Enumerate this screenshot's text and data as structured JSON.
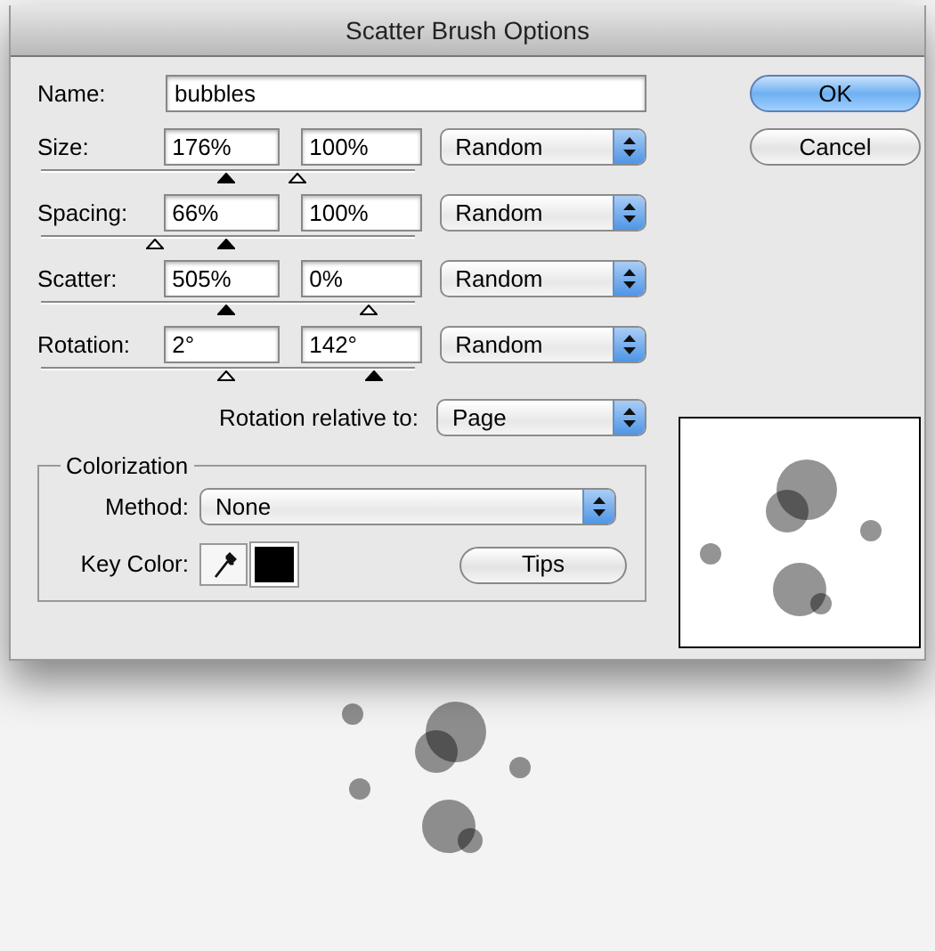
{
  "window": {
    "title": "Scatter Brush Options"
  },
  "name": {
    "label": "Name:",
    "value": "bubbles"
  },
  "rows": [
    {
      "label": "Size:",
      "min": "176%",
      "max": "100%",
      "variation": "Random",
      "thumbs": [
        {
          "level": 0.495,
          "filled": true
        },
        {
          "level": 0.686,
          "filled": false
        }
      ]
    },
    {
      "label": "Spacing:",
      "min": "66%",
      "max": "100%",
      "variation": "Random",
      "thumbs": [
        {
          "level": 0.305,
          "filled": false
        },
        {
          "level": 0.495,
          "filled": true
        }
      ]
    },
    {
      "label": "Scatter:",
      "min": "505%",
      "max": "0%",
      "variation": "Random",
      "thumbs": [
        {
          "level": 0.495,
          "filled": true
        },
        {
          "level": 0.876,
          "filled": false
        }
      ]
    },
    {
      "label": "Rotation:",
      "min": "2°",
      "max": "142°",
      "variation": "Random",
      "thumbs": [
        {
          "level": 0.495,
          "filled": false
        },
        {
          "level": 0.89,
          "filled": true
        }
      ]
    }
  ],
  "rotation_relative": {
    "label": "Rotation relative to:",
    "value": "Page"
  },
  "colorization": {
    "legend": "Colorization",
    "method_label": "Method:",
    "method": "None",
    "key_color_label": "Key Color:",
    "key_color": {
      "color": "#000000"
    },
    "tips": "Tips"
  },
  "buttons": [
    {
      "label": "OK",
      "default": true
    },
    {
      "label": "Cancel",
      "default": false
    }
  ]
}
